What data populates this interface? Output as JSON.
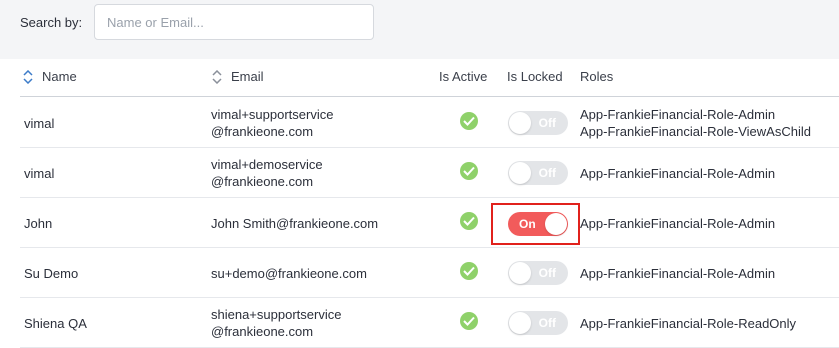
{
  "search": {
    "label": "Search by:",
    "placeholder": "Name or Email...",
    "value": ""
  },
  "table": {
    "columns": {
      "name": "Name",
      "email": "Email",
      "is_active": "Is Active",
      "is_locked": "Is Locked",
      "roles": "Roles"
    },
    "rows": [
      {
        "name": "vimal",
        "email": [
          "vimal+supportservice",
          "@frankieone.com"
        ],
        "active": true,
        "locked": false,
        "locked_label": "Off",
        "roles": [
          "App-FrankieFinancial-Role-Admin",
          "App-FrankieFinancial-Role-ViewAsChild"
        ]
      },
      {
        "name": "vimal",
        "email": [
          "vimal+demoservice",
          "@frankieone.com"
        ],
        "active": true,
        "locked": false,
        "locked_label": "Off",
        "roles": [
          "App-FrankieFinancial-Role-Admin"
        ]
      },
      {
        "name": "John",
        "email": [
          "John Smith@frankieone.com"
        ],
        "active": true,
        "locked": true,
        "locked_label": "On",
        "roles": [
          "App-FrankieFinancial-Role-Admin"
        ]
      },
      {
        "name": "Su Demo",
        "email": [
          "su+demo@frankieone.com"
        ],
        "active": true,
        "locked": false,
        "locked_label": "Off",
        "roles": [
          "App-FrankieFinancial-Role-Admin"
        ]
      },
      {
        "name": "Shiena QA",
        "email": [
          "shiena+supportservice",
          "@frankieone.com"
        ],
        "active": true,
        "locked": false,
        "locked_label": "Off",
        "roles": [
          "App-FrankieFinancial-Role-ReadOnly"
        ]
      }
    ]
  },
  "colors": {
    "toggle_on": "#f25b5b",
    "toggle_off": "#e3e5e8",
    "active_check": "#8fd16a",
    "highlight": "#e1211c"
  },
  "icons": {
    "sort": "sort-updown-icon",
    "active": "check-circle-icon"
  }
}
